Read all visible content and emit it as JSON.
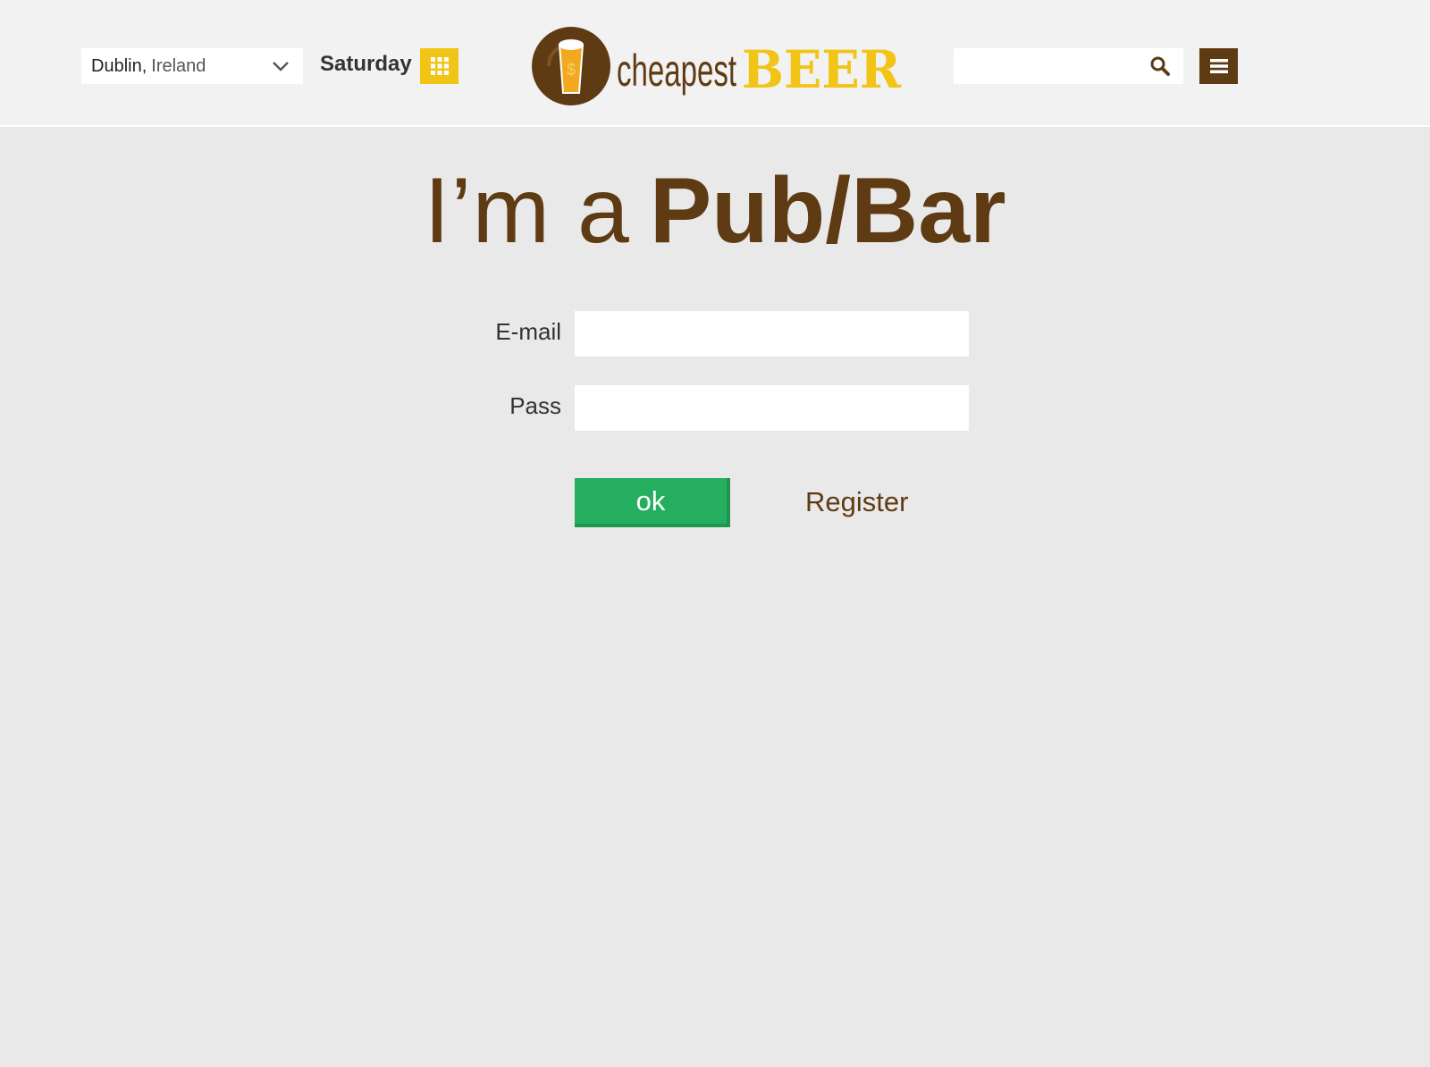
{
  "header": {
    "location": {
      "city": "Dublin,",
      "country": "Ireland"
    },
    "day_label": "Saturday",
    "logo": {
      "text_light": "cheapest",
      "text_bold": "BEER"
    },
    "search": {
      "placeholder": "",
      "value": ""
    }
  },
  "main": {
    "title_light": "I’m a",
    "title_bold": "Pub/Bar",
    "email_label": "E-mail",
    "pass_label": "Pass",
    "ok_label": "ok",
    "register_label": "Register"
  },
  "colors": {
    "brand_brown": "#5f3b14",
    "accent_yellow": "#f1c416",
    "ok_green": "#26ae60",
    "page_bg": "#e9e9e9"
  },
  "icons": [
    "chevron-down-icon",
    "calendar-grid-icon",
    "beer-glass-icon",
    "search-icon",
    "hamburger-menu-icon"
  ]
}
